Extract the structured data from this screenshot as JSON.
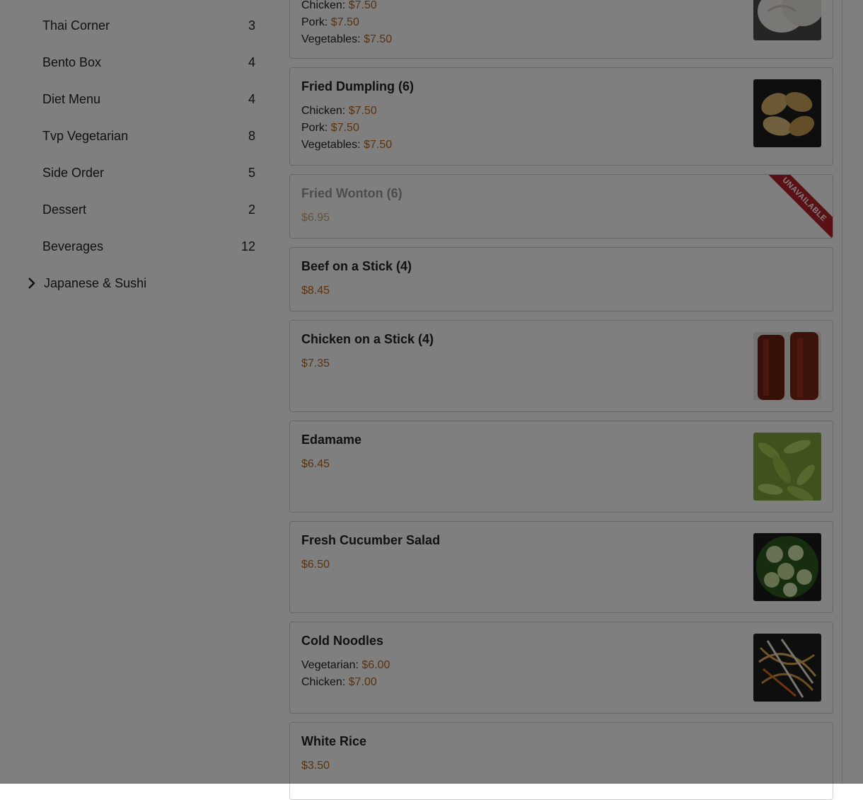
{
  "sidebar": {
    "categories": [
      {
        "label": "Thai Corner",
        "count": "3"
      },
      {
        "label": "Bento Box",
        "count": "4"
      },
      {
        "label": "Diet Menu",
        "count": "4"
      },
      {
        "label": "Tvp Vegetarian",
        "count": "8"
      },
      {
        "label": "Side Order",
        "count": "5"
      },
      {
        "label": "Dessert",
        "count": "2"
      },
      {
        "label": "Beverages",
        "count": "12"
      }
    ],
    "group": {
      "label": "Japanese & Sushi",
      "icon": "chevron-right-icon"
    }
  },
  "menu": {
    "items": [
      {
        "name": "",
        "options": [
          {
            "label": "Chicken:",
            "price": "$7.50"
          },
          {
            "label": "Pork:",
            "price": "$7.50"
          },
          {
            "label": "Vegetables:",
            "price": "$7.50"
          }
        ],
        "image": "steamed-dumplings-photo"
      },
      {
        "name": "Fried Dumpling (6)",
        "options": [
          {
            "label": "Chicken:",
            "price": "$7.50"
          },
          {
            "label": "Pork:",
            "price": "$7.50"
          },
          {
            "label": "Vegetables:",
            "price": "$7.50"
          }
        ],
        "image": "fried-dumpling-photo"
      },
      {
        "name": "Fried Wonton (6)",
        "price": "$6.95",
        "badge": "UNAVAILABLE"
      },
      {
        "name": "Beef on a Stick (4)",
        "price": "$8.45"
      },
      {
        "name": "Chicken on a Stick (4)",
        "price": "$7.35",
        "image": "chicken-on-a-stick-photo"
      },
      {
        "name": "Edamame",
        "price": "$6.45",
        "image": "edamame-photo"
      },
      {
        "name": "Fresh Cucumber Salad",
        "price": "$6.50",
        "image": "cucumber-salad-photo"
      },
      {
        "name": "Cold Noodles",
        "options": [
          {
            "label": "Vegetarian:",
            "price": "$6.00"
          },
          {
            "label": "Chicken:",
            "price": "$7.00"
          }
        ],
        "image": "cold-noodles-photo"
      },
      {
        "name": "White Rice",
        "price": "$3.50"
      }
    ]
  },
  "colors": {
    "price": "#b5651d",
    "unavailable_ribbon": "#b3222b",
    "overlay": "rgba(0,0,0,0.5)"
  }
}
